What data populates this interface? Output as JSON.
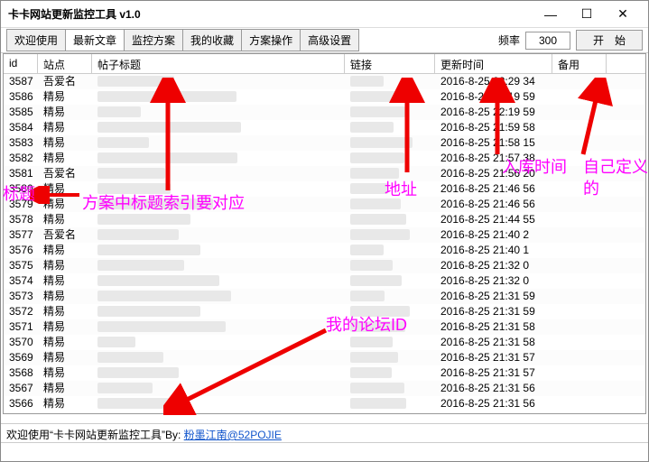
{
  "window": {
    "title": "卡卡网站更新监控工具 v1.0"
  },
  "tabs": [
    "欢迎使用",
    "最新文章",
    "监控方案",
    "我的收藏",
    "方案操作",
    "高级设置"
  ],
  "freq": {
    "label": "频率",
    "value": "300"
  },
  "start": "开　始",
  "columns": {
    "id": "id",
    "site": "站点",
    "title": "帖子标题",
    "link": "链接",
    "time": "更新时间",
    "spare": "备用"
  },
  "rows": [
    {
      "id": "3587",
      "site": "吾爱名",
      "time": "2016-8-25 22:29 34"
    },
    {
      "id": "3586",
      "site": "精易",
      "time": "2016-8-25 22:19 59"
    },
    {
      "id": "3585",
      "site": "精易",
      "time": "2016-8-25 22:19 59"
    },
    {
      "id": "3584",
      "site": "精易",
      "time": "2016-8-25 21:59 58"
    },
    {
      "id": "3583",
      "site": "精易",
      "time": "2016-8-25 21:58 15"
    },
    {
      "id": "3582",
      "site": "精易",
      "time": "2016-8-25 21:57 38"
    },
    {
      "id": "3581",
      "site": "吾爱名",
      "time": "2016-8-25 21:56 20"
    },
    {
      "id": "3580",
      "site": "精易",
      "time": "2016-8-25 21:46 56"
    },
    {
      "id": "3579",
      "site": "精易",
      "time": "2016-8-25 21:46 56"
    },
    {
      "id": "3578",
      "site": "精易",
      "time": "2016-8-25 21:44 55"
    },
    {
      "id": "3577",
      "site": "吾爱名",
      "time": "2016-8-25 21:40 2"
    },
    {
      "id": "3576",
      "site": "精易",
      "time": "2016-8-25 21:40 1"
    },
    {
      "id": "3575",
      "site": "精易",
      "time": "2016-8-25 21:32 0"
    },
    {
      "id": "3574",
      "site": "精易",
      "time": "2016-8-25 21:32 0"
    },
    {
      "id": "3573",
      "site": "精易",
      "time": "2016-8-25 21:31 59"
    },
    {
      "id": "3572",
      "site": "精易",
      "time": "2016-8-25 21:31 59"
    },
    {
      "id": "3571",
      "site": "精易",
      "time": "2016-8-25 21:31 58"
    },
    {
      "id": "3570",
      "site": "精易",
      "time": "2016-8-25 21:31 58"
    },
    {
      "id": "3569",
      "site": "精易",
      "time": "2016-8-25 21:31 57"
    },
    {
      "id": "3568",
      "site": "精易",
      "time": "2016-8-25 21:31 57"
    },
    {
      "id": "3567",
      "site": "精易",
      "time": "2016-8-25 21:31 56"
    },
    {
      "id": "3566",
      "site": "精易",
      "time": "2016-8-25 21:31 56"
    }
  ],
  "status": {
    "prefix": "欢迎使用“卡卡网站更新监控工具”By: ",
    "link": "粉墨江南@52POJIE"
  },
  "annotations": {
    "title_label": "标题",
    "title_note": "方案中标题索引要对应",
    "addr": "地址",
    "time_note": "入库时间",
    "custom": "自己定义的",
    "forum": "我的论坛ID"
  }
}
